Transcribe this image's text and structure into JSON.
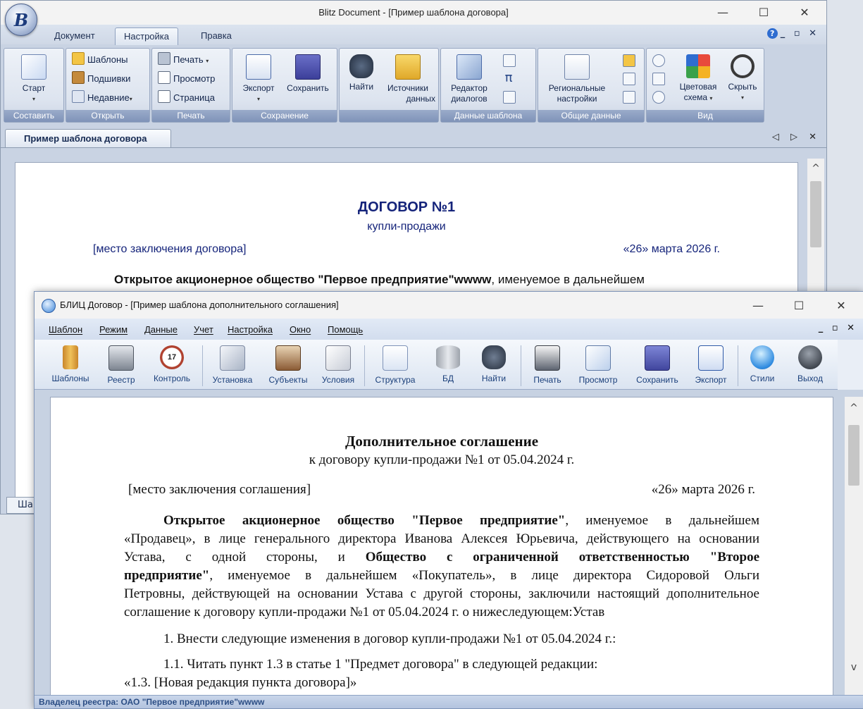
{
  "back_window": {
    "title": "Blitz Document - [Пример шаблона договора]",
    "orb_letter": "B",
    "controls": {
      "minimize": "—",
      "maximize": "☐",
      "close": "✕"
    },
    "tabs": [
      "Документ",
      "Настройка",
      "Правка"
    ],
    "help": "?",
    "mdi_controls": "_ ▫ ✕",
    "ribbon": {
      "groups": [
        "Составить",
        "Открыть",
        "Печать",
        "Сохранение",
        "",
        "Данные шаблона",
        "Общие данные",
        "Вид"
      ],
      "start": "Старт",
      "open_templates": "Шаблоны",
      "open_bindings": "Подшивки",
      "open_recent": "Недавние",
      "print_print": "Печать",
      "print_preview": "Просмотр",
      "print_page": "Страница",
      "export": "Экспорт",
      "save": "Сохранить",
      "find": "Найти",
      "sources_l1": "Источники",
      "sources_l2": "данных",
      "dialog_l1": "Редактор",
      "dialog_l2": "диалогов",
      "pi_symbol": "π",
      "regional_l1": "Региональные",
      "regional_l2": "настройки",
      "color_l1": "Цветовая",
      "color_l2": "схема",
      "hide": "Скрыть",
      "arrow": "▾"
    },
    "doc_tab": "Пример шаблона договора",
    "doc_tab_nav": "◁ ▷ ✕",
    "hidden_tab_text": "Ша",
    "scroll_up": "^",
    "document": {
      "heading": "ДОГОВОР №1",
      "subheading": "купли-продажи",
      "place": "[место заключения договора]",
      "date": "«26» марта 2026 г.",
      "para_bold": "Открытое акционерное общество \"Первое предприятие\"wwww",
      "para_rest": ", именуемое в дальнейшем"
    }
  },
  "front_window": {
    "title": "БЛИЦ Договор - [Пример шаблона дополнительного соглашения]",
    "controls": {
      "minimize": "—",
      "maximize": "☐",
      "close": "✕"
    },
    "menu": [
      "Шаблон",
      "Режим",
      "Данные",
      "Учет",
      "Настройка",
      "Окно",
      "Помощь"
    ],
    "mdi_controls": "_ ▫ ✕",
    "toolbar": [
      "Шаблоны",
      "Реестр",
      "Контроль",
      "Установка",
      "Субъекты",
      "Условия",
      "Структура",
      "БД",
      "Найти",
      "Печать",
      "Просмотр",
      "Сохранить",
      "Экспорт",
      "Стили",
      "Выход"
    ],
    "calendar_day": "17",
    "scroll_up": "^",
    "scroll_down": "v",
    "document": {
      "heading": "Дополнительное соглашение",
      "subheading": "к договору купли-продажи №1 от  05.04.2024 г.",
      "place": "[место заключения соглашения]",
      "date": "«26» марта 2026 г.",
      "line1_bold": "Открытое акционерное общество \"Первое предприятие\"",
      "line1_rest": ", именуемое в дальнейшем",
      "line2": "«Продавец», в лице генерального директора Иванова Алексея Юрьевича, действующего на основании",
      "line3_pre": "Устава, с одной стороны, и ",
      "line3_bold": "Общество с ограниченной ответственностью \"Второе",
      "line4_bold": "предприятие\"",
      "line4_rest": ", именуемое в дальнейшем «Покупатель», в лице директора Сидоровой Ольги",
      "line5": "Петровны, действующей на основании Устава с другой стороны, заключили настоящий дополнительное",
      "line6": "соглашение к договору купли-продажи №1 от  05.04.2024 г.  о нижеследующем:Устав",
      "item1": "1. Внести следующие изменения в договор купли-продажи №1 от 05.04.2024 г.:",
      "item11": "1.1. Читать пункт 1.3 в статье 1 \"Предмет договора\" в следующей редакции:",
      "item13": "«1.3. [Новая редакция пункта договора]»"
    },
    "status": "Владелец реестра: ОАО \"Первое предприятие\"wwww"
  }
}
